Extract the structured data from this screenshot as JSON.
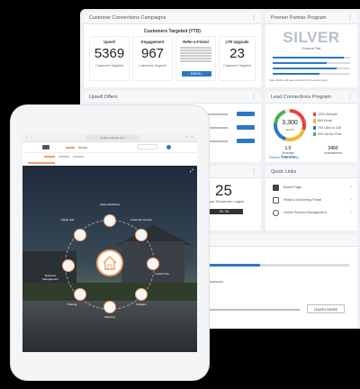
{
  "campaigns": {
    "title": "Customer Connections Campaigns",
    "subtitle": "Customers Targeted (YTD)",
    "metrics": [
      {
        "label": "Upsell",
        "value": "5369",
        "sub": "Customers Targeted"
      },
      {
        "label": "Engagement",
        "value": "967",
        "sub": "Customers Targeted"
      },
      {
        "label": "LTR Upgrade",
        "value": "23",
        "sub": "Customers Targeted"
      }
    ],
    "refer": {
      "label": "Refer-a-Friend",
      "button": "ENROLL"
    }
  },
  "partner": {
    "title": "Premier Partner Program",
    "tier": "SILVER",
    "tier_sub": "Current Tier",
    "note": "Note: Metrics will reset at the end of the current year"
  },
  "upsell": {
    "title": "Upsell Offers"
  },
  "lead": {
    "title": "Lead Connections Program",
    "gauge_value": "3,300",
    "gauge_label": "LEADS",
    "legend": [
      "1200 Website",
      "800 Email",
      "700 Click to Call",
      "600 Via the Print"
    ],
    "stats": [
      {
        "value": "1.0",
        "label": "Average Response"
      },
      {
        "value": "2450",
        "label": "Unanswered"
      }
    ],
    "link": "Review Lead Activity"
  },
  "logins": {
    "value": "25",
    "label": "Unique Showroom Logins",
    "ratio": "25 / 30"
  },
  "quick": {
    "title": "Quick Links",
    "items": [
      "Brand Page",
      "Retail & Marketing Portal",
      "Online Review Management"
    ]
  },
  "bottom": {
    "button": "LEARN MORE"
  },
  "tablet": {
    "url": "dealer.example.com",
    "nodes": [
      "Sales Marketing",
      "Customer Service",
      "Install Tools",
      "Rebates",
      "Warranty",
      "Training",
      "Business Management",
      "Digital Hub"
    ],
    "center": "Home"
  },
  "colors": {
    "accent": "#2b78c5",
    "orange": "#f0a069"
  }
}
